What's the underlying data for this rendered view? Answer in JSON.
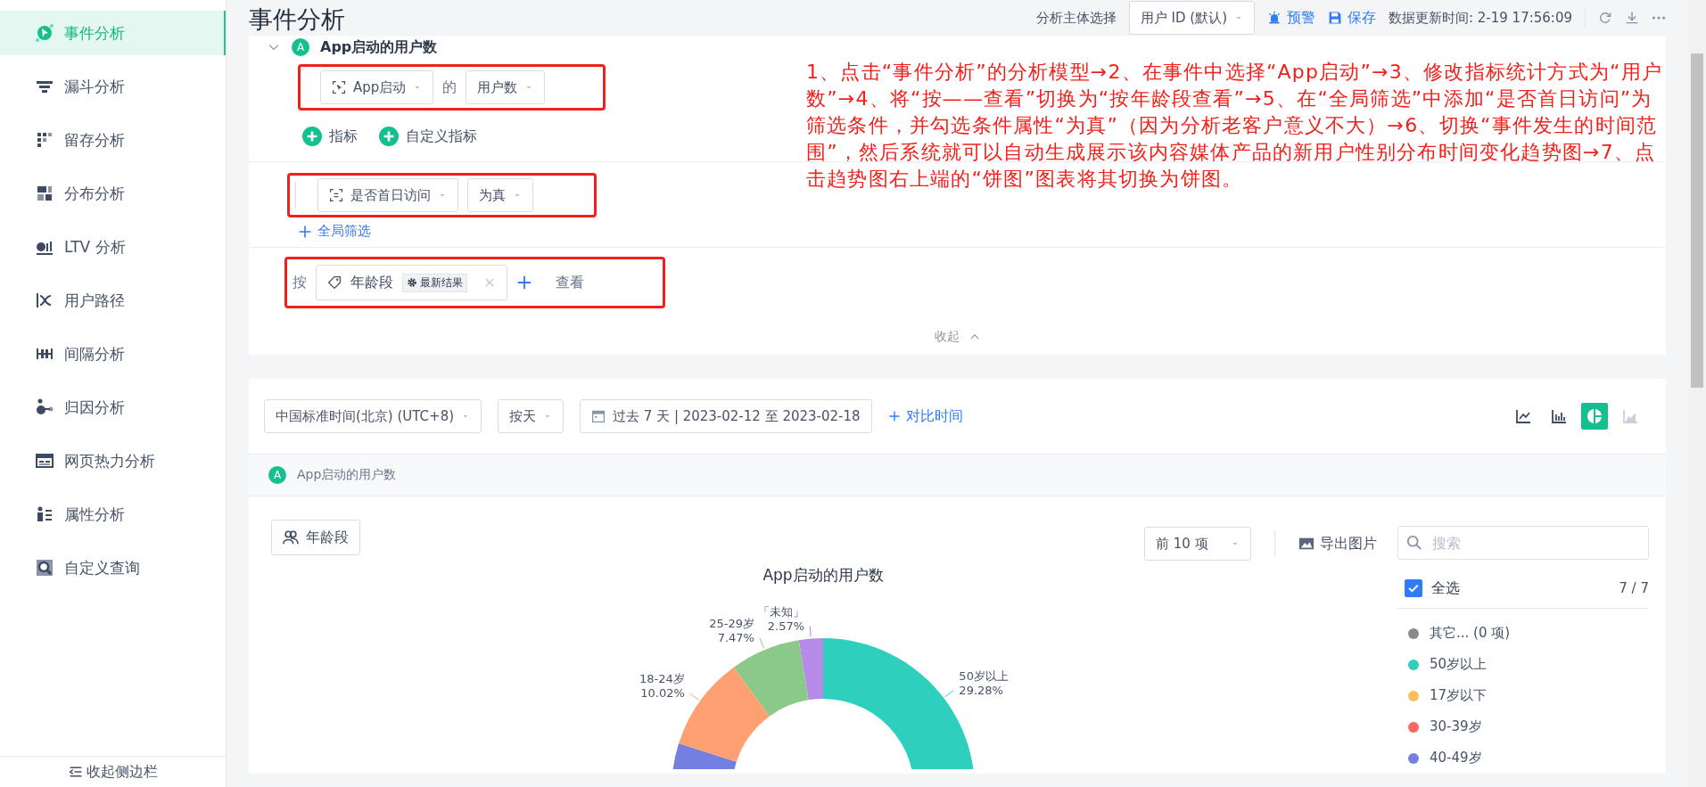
{
  "header": {
    "title": "事件分析",
    "subject_label": "分析主体选择",
    "subject_select": "用户 ID (默认)",
    "alert": "预警",
    "save": "保存",
    "updated": "数据更新时间: 2-19 17:56:09"
  },
  "sidebar": {
    "items": [
      {
        "label": "事件分析",
        "selected": true
      },
      {
        "label": "漏斗分析",
        "selected": false
      },
      {
        "label": "留存分析",
        "selected": false
      },
      {
        "label": "分布分析",
        "selected": false
      },
      {
        "label": "LTV 分析",
        "selected": false
      },
      {
        "label": "用户路径",
        "selected": false
      },
      {
        "label": "间隔分析",
        "selected": false
      },
      {
        "label": "归因分析",
        "selected": false
      },
      {
        "label": "网页热力分析",
        "selected": false
      },
      {
        "label": "属性分析",
        "selected": false
      },
      {
        "label": "自定义查询",
        "selected": false
      }
    ],
    "collapse": "收起侧边栏"
  },
  "config": {
    "metric": {
      "badge": "A",
      "title": "App启动的用户数",
      "expanded": true,
      "event": "App启动",
      "joiner": "的",
      "measure": "用户数"
    },
    "add_buttons": [
      "指标",
      "自定义指标"
    ],
    "filter": {
      "property": "是否首日访问",
      "operator": "为真"
    },
    "add_filter": "全局筛选",
    "group": {
      "prefix": "按",
      "property": "年龄段",
      "chip": "最新结果",
      "suffix": "查看"
    },
    "collapse": "收起"
  },
  "annotation": "1、点击“事件分析”的分析模型→2、在事件中选择“App启动”→3、修改指标统计方式为“用户数”→4、将“按——查看”切换为“按年龄段查看”→5、在“全局筛选”中添加“是否首日访问”为筛选条件，并勾选条件属性“为真”（因为分析老客户意义不大）→6、切换“事件发生的时间范围”，然后系统就可以自动生成展示该内容媒体产品的新用户性别分布时间变化趋势图→7、点击趋势图右上端的“饼图”图表将其切换为饼图。",
  "result": {
    "timezone": "中国标准时间(北京) (UTC+8)",
    "granularity": "按天",
    "date_range": "过去 7 天 | 2023-02-12 至 2023-02-18",
    "compare": "对比时间",
    "chart_types": [
      {
        "kind": "line",
        "selected": false,
        "disabled": false
      },
      {
        "kind": "bar",
        "selected": false,
        "disabled": false
      },
      {
        "kind": "pie",
        "selected": true,
        "disabled": false
      },
      {
        "kind": "area",
        "selected": false,
        "disabled": true
      }
    ],
    "metric_tag": {
      "badge": "A",
      "label": "App启动的用户数"
    },
    "group_button": "年龄段",
    "top_n": "前 10 项",
    "export": "导出图片",
    "search": {
      "placeholder": "搜索"
    },
    "legend": {
      "select_all": {
        "label": "全选",
        "checked": true
      },
      "count": "7 / 7",
      "items": [
        {
          "label": "其它... (0 项)",
          "color": "#8a8a8a"
        },
        {
          "label": "50岁以上",
          "color": "#2ecfbd"
        },
        {
          "label": "17岁以下",
          "color": "#ffbd5e"
        },
        {
          "label": "30-39岁",
          "color": "#fb6762"
        },
        {
          "label": "40-49岁",
          "color": "#7480e0"
        }
      ]
    },
    "donut": {
      "title": "App启动的用户数",
      "slices": [
        {
          "category": "「未知」",
          "value": "2.57%",
          "color": "#b68ae8"
        },
        {
          "category": "25-29岁",
          "value": "7.47%",
          "color": "#8bc98b"
        },
        {
          "category": "18-24岁",
          "value": "10.02%",
          "color": "#ffa073"
        },
        {
          "category": "50岁以上",
          "value": "29.28%",
          "color": "#2ecfbd"
        }
      ]
    }
  }
}
